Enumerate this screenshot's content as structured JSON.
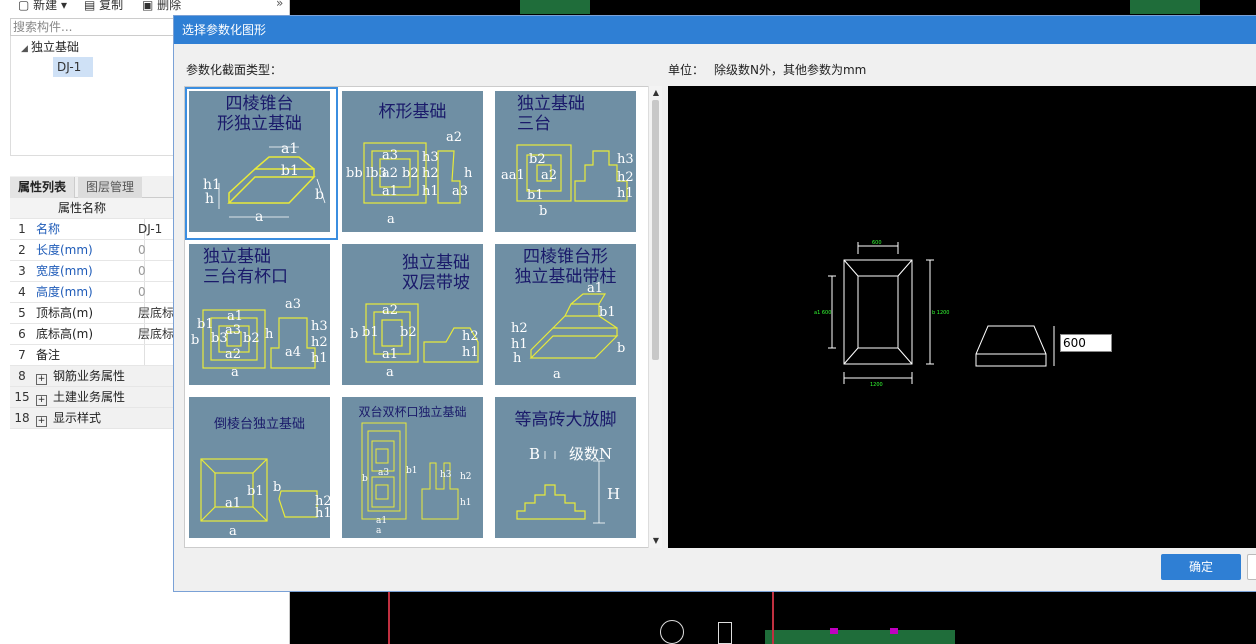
{
  "toolbar": {
    "new_label": "新建",
    "copy_label": "复制",
    "delete_label": "删除"
  },
  "search": {
    "placeholder": "搜索构件..."
  },
  "tree": {
    "root": "独立基础",
    "child": "DJ-1"
  },
  "props_tabs": {
    "active": "属性列表",
    "inactive": "图层管理"
  },
  "props": {
    "header": "属性名称",
    "rows": [
      {
        "num": "1",
        "name": "名称",
        "value": "DJ-1"
      },
      {
        "num": "2",
        "name": "长度(mm)",
        "value": "0"
      },
      {
        "num": "3",
        "name": "宽度(mm)",
        "value": "0"
      },
      {
        "num": "4",
        "name": "高度(mm)",
        "value": "0"
      },
      {
        "num": "5",
        "name": "顶标高(m)",
        "value": "层底标"
      },
      {
        "num": "6",
        "name": "底标高(m)",
        "value": "层底标"
      },
      {
        "num": "7",
        "name": "备注",
        "value": ""
      },
      {
        "num": "8",
        "name": "钢筋业务属性",
        "value": ""
      },
      {
        "num": "15",
        "name": "土建业务属性",
        "value": ""
      },
      {
        "num": "18",
        "name": "显示样式",
        "value": ""
      }
    ]
  },
  "dialog": {
    "title": "选择参数化图形",
    "type_label": "参数化截面类型：",
    "unit_label": "单位：",
    "unit_value": "除级数N外，其他参数为mm",
    "ok_label": "确定",
    "height_value": "600"
  },
  "gallery": [
    {
      "title": "四棱锥台形独立基础",
      "line1": "四棱锥台",
      "line2": "形独立基础",
      "selected": true
    },
    {
      "title": "杯形基础",
      "line1": "杯形基础",
      "line2": ""
    },
    {
      "title": "独立基础三台",
      "line1": "独立基础",
      "line2": "三台"
    },
    {
      "title": "独立基础三台有杯口",
      "line1": "独立基础",
      "line2": "三台有杯口"
    },
    {
      "title": "独立基础双层带坡",
      "line1": "独立基础",
      "line2": "双层带坡"
    },
    {
      "title": "四棱锥台形独立基础带柱",
      "line1": "四棱锥台形",
      "line2": "独立基础带柱"
    },
    {
      "title": "倒棱台独立基础",
      "line1": "倒棱台独立基础",
      "line2": ""
    },
    {
      "title": "双台双杯口独立基础",
      "line1": "双台双杯口独立基础",
      "line2": ""
    },
    {
      "title": "等高砖大放脚",
      "line1": "等高砖大放脚",
      "line2": ""
    }
  ],
  "colors": {
    "accent": "#2f7fd4",
    "thumb_bg": "#6f8fa4",
    "line": "#e8ea3a"
  }
}
